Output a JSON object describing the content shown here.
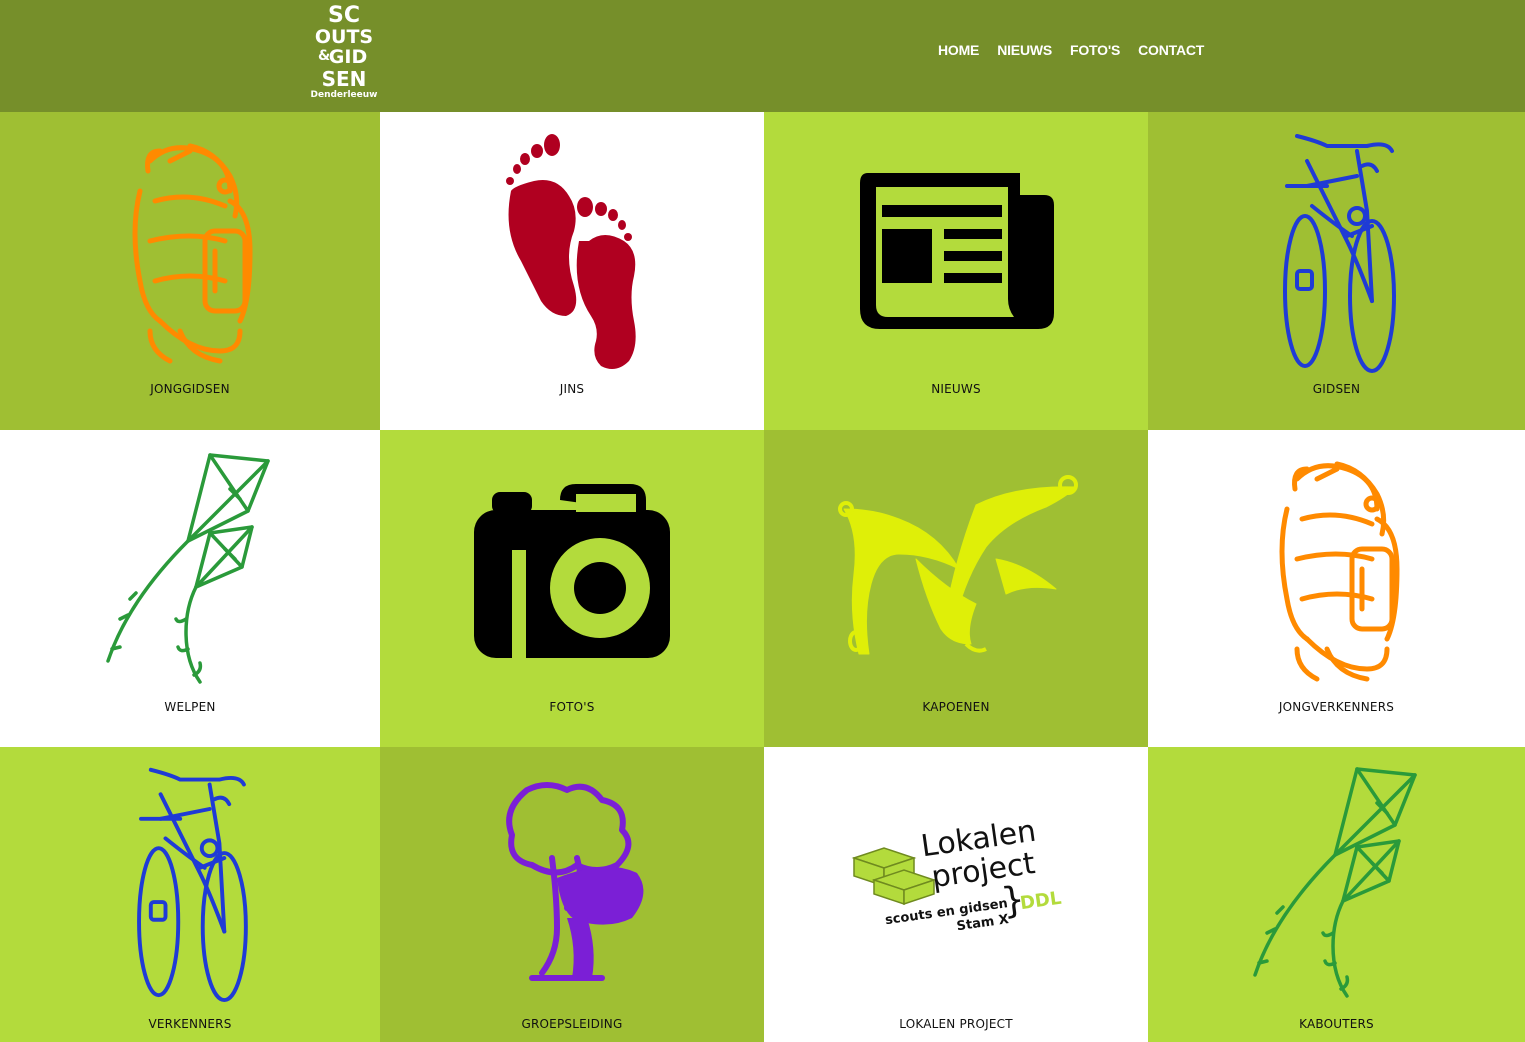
{
  "header": {
    "logo_text": [
      "SC",
      "OUTS",
      "GID",
      "SEN"
    ],
    "logo_sub": "Denderleeuw",
    "nav": [
      {
        "label": "HOME"
      },
      {
        "label": "NIEUWS"
      },
      {
        "label": "FOTO'S"
      },
      {
        "label": "CONTACT"
      }
    ]
  },
  "tiles": [
    {
      "label": "JONGGIDSEN",
      "icon": "backpack-icon",
      "color": "#ff8a00"
    },
    {
      "label": "JINS",
      "icon": "footprints-icon",
      "color": "#b00020"
    },
    {
      "label": "NIEUWS",
      "icon": "newspaper-icon",
      "color": "#000000"
    },
    {
      "label": "GIDSEN",
      "icon": "bicycle-icon",
      "color": "#1f3bd6"
    },
    {
      "label": "WELPEN",
      "icon": "kite-icon",
      "color": "#2a9a3a"
    },
    {
      "label": "FOTO'S",
      "icon": "camera-icon",
      "color": "#000000"
    },
    {
      "label": "KAPOENEN",
      "icon": "banana-icon",
      "color": "#dfef08"
    },
    {
      "label": "JONGVERKENNERS",
      "icon": "backpack-icon",
      "color": "#ff8a00"
    },
    {
      "label": "VERKENNERS",
      "icon": "bicycle-icon",
      "color": "#1f3bd6"
    },
    {
      "label": "GROEPSLEIDING",
      "icon": "tree-icon",
      "color": "#7b1fd6"
    },
    {
      "label": "LOKALEN PROJECT",
      "icon": "lokalen-project-logo",
      "color": "#111111"
    },
    {
      "label": "KABOUTERS",
      "icon": "kite-icon",
      "color": "#2a9a3a"
    }
  ],
  "lokalen_logo": {
    "line1": "Lokalen",
    "line2": "project",
    "line3": "scouts en gidsen",
    "line4": "Stam X",
    "mark": "DDL"
  }
}
